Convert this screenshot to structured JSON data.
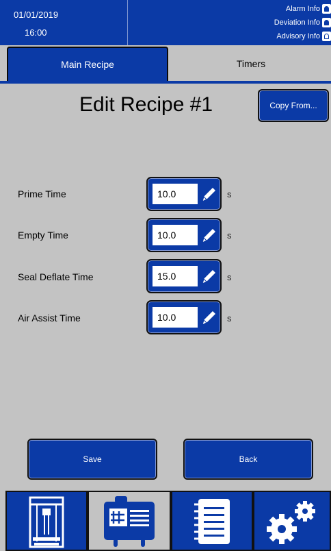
{
  "header": {
    "date": "01/01/2019",
    "time": "16:00",
    "alarm_info": "Alarm Info",
    "deviation_info": "Deviation Info",
    "advisory_info": "Advisory Info"
  },
  "tabs": [
    {
      "label": "Main Recipe",
      "active": true
    },
    {
      "label": "Timers",
      "active": false
    }
  ],
  "title": "Edit Recipe #1",
  "copy_from_label": "Copy From...",
  "timers": [
    {
      "label": "Prime Time",
      "value": "10.0",
      "unit": "s"
    },
    {
      "label": "Empty Time",
      "value": "10.0",
      "unit": "s"
    },
    {
      "label": "Seal Deflate Time",
      "value": "15.0",
      "unit": "s"
    },
    {
      "label": "Air Assist Time",
      "value": "10.0",
      "unit": "s"
    }
  ],
  "buttons": {
    "save": "Save",
    "back": "Back"
  },
  "nav": [
    {
      "icon": "machine-icon"
    },
    {
      "icon": "recipe-card-icon",
      "active": true
    },
    {
      "icon": "notebook-icon"
    },
    {
      "icon": "gears-icon"
    }
  ],
  "colors": {
    "primary": "#0b3aa6",
    "background": "#c3c3c3"
  }
}
